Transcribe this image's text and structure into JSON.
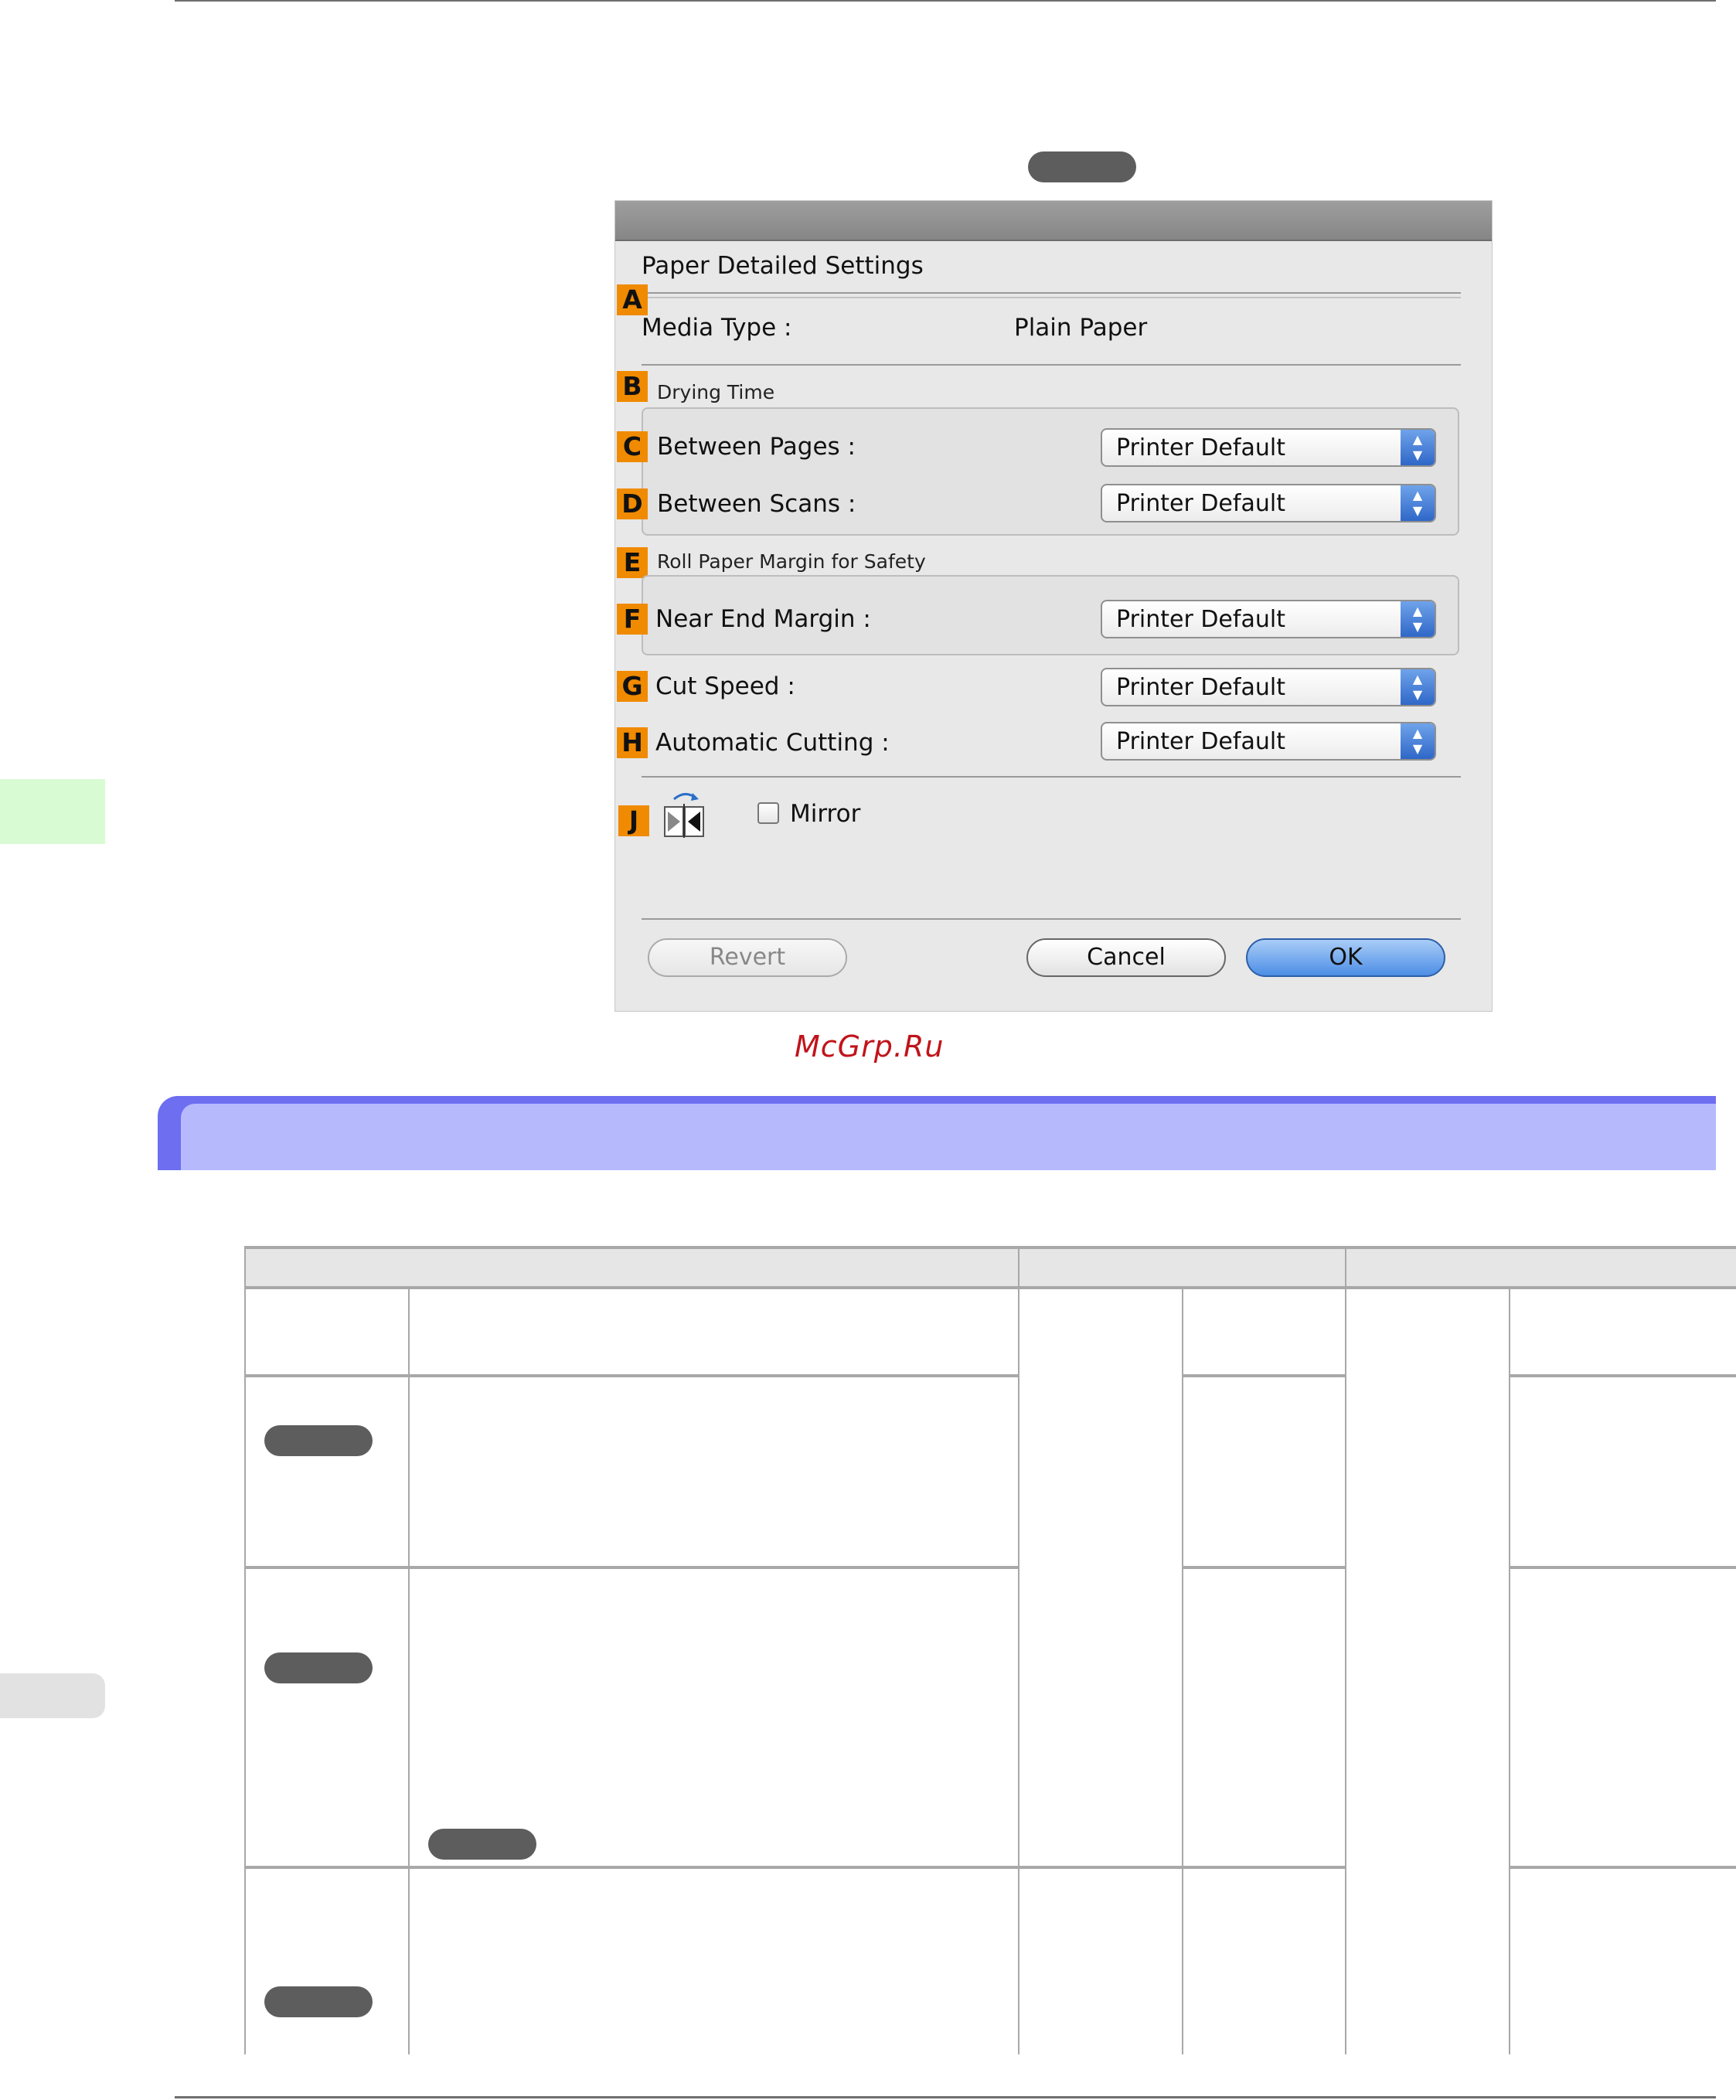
{
  "dialog": {
    "header": "Paper Detailed Settings",
    "media_type_label": "Media Type :",
    "media_type_value": "Plain Paper",
    "drying_time_label": "Drying Time",
    "between_pages_label": "Between Pages :",
    "between_pages_value": "Printer Default",
    "between_scans_label": "Between Scans :",
    "between_scans_value": "Printer Default",
    "roll_margin_label": "Roll Paper Margin for Safety",
    "near_end_label": "Near End Margin :",
    "near_end_value": "Printer Default",
    "cut_speed_label": "Cut Speed :",
    "cut_speed_value": "Printer Default",
    "auto_cutting_label": "Automatic Cutting :",
    "auto_cutting_value": "Printer Default",
    "mirror_label": "Mirror",
    "mirror_checked": false,
    "revert_label": "Revert",
    "cancel_label": "Cancel",
    "ok_label": "OK"
  },
  "badges": {
    "a": "A",
    "b": "B",
    "c": "C",
    "d": "D",
    "e": "E",
    "f": "F",
    "g": "G",
    "h": "H",
    "j": "J"
  },
  "watermark": "McGrp.Ru",
  "colors": {
    "badge": "#f08a00",
    "section_banner": "#b7b9fd",
    "section_banner_edge": "#6d6ef0",
    "side_tab_green": "#d9fbd3",
    "side_tab_gray": "#e2e2e2",
    "ok_button": "#4d8ee6",
    "watermark": "#c0141b"
  },
  "icons": {
    "mirror": "mirror-flip-icon",
    "select_arrows": "updown-arrows-icon"
  }
}
